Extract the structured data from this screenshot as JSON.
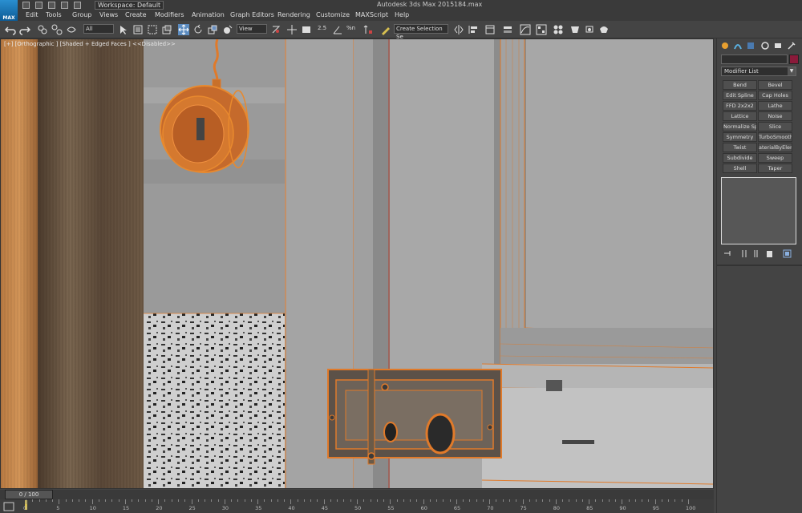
{
  "window": {
    "app_title": "Autodesk 3ds Max  2015",
    "file_name": "184.max",
    "workspace": "Workspace: Default",
    "logo_text": "MAX"
  },
  "menu": [
    "Edit",
    "Tools",
    "Group",
    "Views",
    "Create",
    "Modifiers",
    "Animation",
    "Graph Editors",
    "Rendering",
    "Customize",
    "MAXScript",
    "Help"
  ],
  "toolbar": {
    "filter_dropdown": "All",
    "reference_coord": "View",
    "selection_set": "Create Selection Se",
    "snap_label": "2.5",
    "percent_label": "%n"
  },
  "viewport": {
    "label": "[+] [Orthographic ] [Shaded + Edged Faces ]  <<Disabled>>"
  },
  "command_panel": {
    "modifier_list": "Modifier List",
    "modifier_buttons": [
      "Bend",
      "Bevel",
      "Edit Spline",
      "Cap Holes",
      "FFD 2x2x2",
      "Lathe",
      "Lattice",
      "Noise",
      "Normalize Spl.",
      "Slice",
      "Symmetry",
      "TurboSmooth",
      "Twist",
      "aterialByEleme",
      "Subdivide",
      "Sweep",
      "Shell",
      "Taper"
    ],
    "swatch_color": "#8a1a3a"
  },
  "timeline": {
    "frame_display": "0 / 100",
    "ticks": [
      "0",
      "5",
      "10",
      "15",
      "20",
      "25",
      "30",
      "35",
      "40",
      "45",
      "50",
      "55",
      "60",
      "65",
      "70",
      "75",
      "80",
      "85",
      "90",
      "95",
      "100"
    ]
  },
  "colors": {
    "selection_orange": "#e07a2a",
    "ui_dark": "#3a3a3a",
    "ui_mid": "#444444"
  }
}
